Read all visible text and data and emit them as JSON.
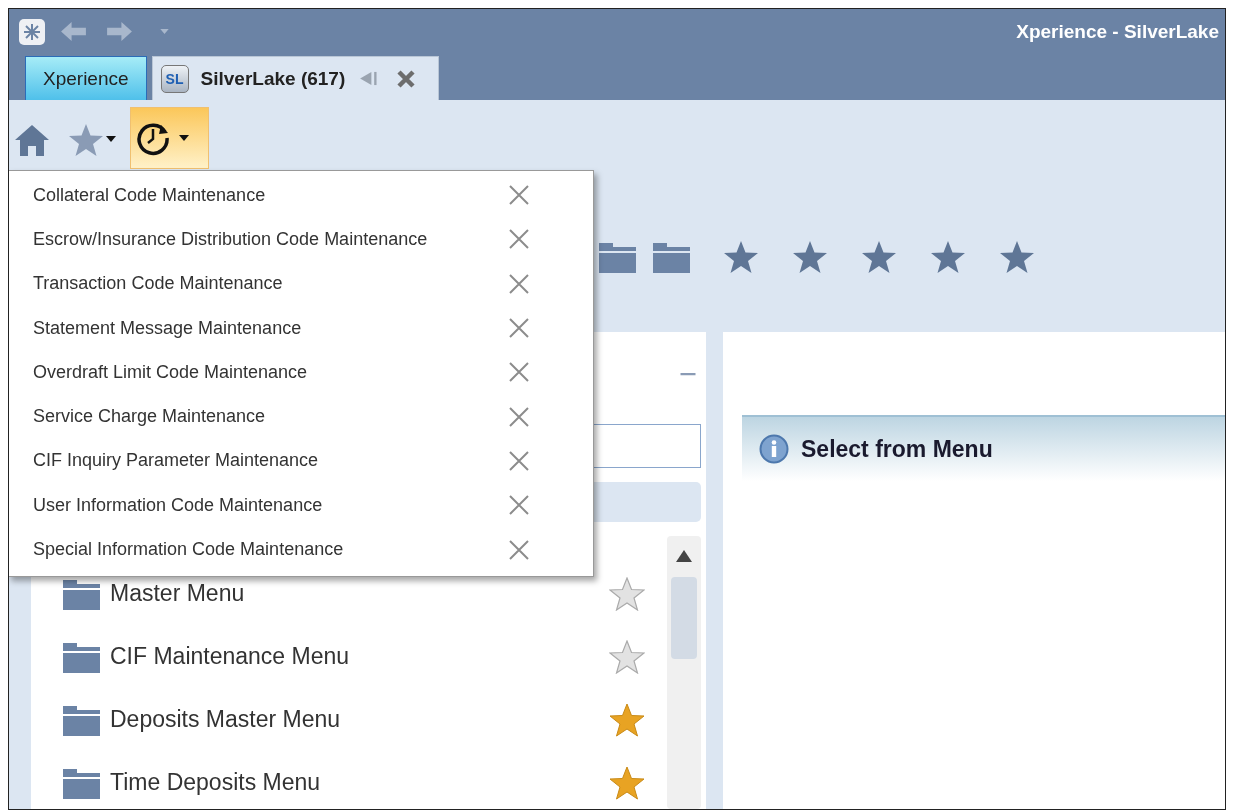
{
  "window": {
    "title": "Xperience - SilverLake"
  },
  "tabs": [
    {
      "label": "Xperience",
      "selected": false,
      "kind": "home"
    },
    {
      "label": "SilverLake (617)",
      "selected": true,
      "kind": "session",
      "icon_text": "SL"
    }
  ],
  "toolbar": {
    "history_active": true
  },
  "shortcuts": [
    {
      "kind": "folder"
    },
    {
      "kind": "folder"
    },
    {
      "kind": "star"
    },
    {
      "kind": "star"
    },
    {
      "kind": "star"
    },
    {
      "kind": "star"
    },
    {
      "kind": "star"
    }
  ],
  "recent_menu": {
    "open": true,
    "items": [
      {
        "label": "Collateral Code Maintenance"
      },
      {
        "label": "Escrow/Insurance Distribution Code Maintenance"
      },
      {
        "label": "Transaction Code Maintenance"
      },
      {
        "label": "Statement Message Maintenance"
      },
      {
        "label": "Overdraft Limit Code Maintenance"
      },
      {
        "label": "Service Charge Maintenance"
      },
      {
        "label": "CIF Inquiry Parameter Maintenance"
      },
      {
        "label": "User Information Code Maintenance"
      },
      {
        "label": "Special Information Code Maintenance"
      }
    ]
  },
  "menu_list": {
    "items": [
      {
        "label": "Master Menu",
        "favorite": false
      },
      {
        "label": "CIF Maintenance Menu",
        "favorite": false
      },
      {
        "label": "Deposits Master Menu",
        "favorite": true
      },
      {
        "label": "Time Deposits Menu",
        "favorite": true
      }
    ]
  },
  "content": {
    "message": "Select from Menu"
  }
}
